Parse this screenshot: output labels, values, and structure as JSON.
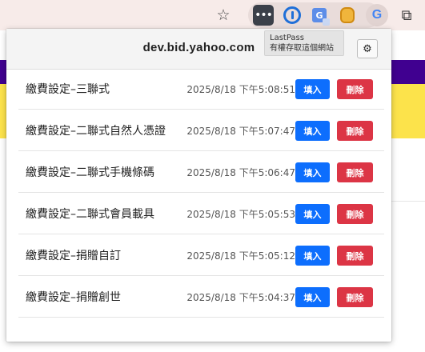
{
  "toolbar": {
    "icons": [
      "star-icon",
      "lastpass-icon",
      "1password-icon",
      "google-translate-icon",
      "honey-icon",
      "google-icon",
      "extensions-puzzle-icon"
    ],
    "lastpass_glyph": "•••",
    "translate_glyph": "G",
    "google_glyph": "G"
  },
  "tooltip": {
    "title": "LastPass",
    "subtitle": "有權存取這個網站"
  },
  "popup": {
    "domain": "dev.bid.yahoo.com",
    "settings_icon": "⚙",
    "fill_label": "填入",
    "delete_label": "刪除",
    "entries": [
      {
        "name": "繳費設定–三聯式",
        "time": "2025/8/18 下午5:08:51"
      },
      {
        "name": "繳費設定–二聯式自然人憑證",
        "time": "2025/8/18 下午5:07:47"
      },
      {
        "name": "繳費設定–二聯式手機條碼",
        "time": "2025/8/18 下午5:06:47"
      },
      {
        "name": "繳費設定–二聯式會員載具",
        "time": "2025/8/18 下午5:05:53"
      },
      {
        "name": "繳費設定–捐贈自訂",
        "time": "2025/8/18 下午5:05:12"
      },
      {
        "name": "繳費設定–捐贈創世",
        "time": "2025/8/18 下午5:04:37"
      }
    ]
  },
  "colors": {
    "fill_button": "#0d6efd",
    "delete_button": "#dc3545",
    "page_yellow": "#fce34b",
    "page_purple": "#400090"
  }
}
